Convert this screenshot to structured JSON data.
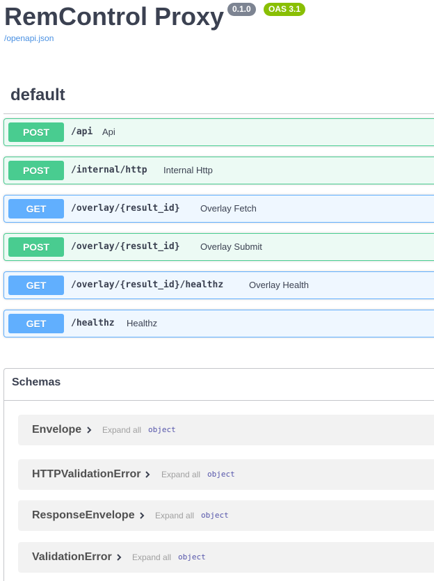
{
  "header": {
    "title": "RemControl Proxy",
    "version": "0.1.0",
    "oas": "OAS 3.1",
    "spec_link": "/openapi.json"
  },
  "section": {
    "title": "default"
  },
  "operations": [
    {
      "method": "POST",
      "path": "/api",
      "summary": "Api"
    },
    {
      "method": "POST",
      "path": "/internal/http",
      "summary": "Internal Http"
    },
    {
      "method": "GET",
      "path": "/overlay/{result_id}",
      "summary": "Overlay Fetch"
    },
    {
      "method": "POST",
      "path": "/overlay/{result_id}",
      "summary": "Overlay Submit"
    },
    {
      "method": "GET",
      "path": "/overlay/{result_id}/healthz",
      "summary": "Overlay Health"
    },
    {
      "method": "GET",
      "path": "/healthz",
      "summary": "Healthz"
    }
  ],
  "schemas": {
    "title": "Schemas",
    "items": [
      {
        "name": "Envelope",
        "expand": "Expand all",
        "type": "object"
      },
      {
        "name": "HTTPValidationError",
        "expand": "Expand all",
        "type": "object"
      },
      {
        "name": "ResponseEnvelope",
        "expand": "Expand all",
        "type": "object"
      },
      {
        "name": "ValidationError",
        "expand": "Expand all",
        "type": "object"
      }
    ]
  },
  "colors": {
    "post": "#49cc90",
    "get": "#61affe",
    "version_badge": "#7d8492",
    "oas_badge": "#89bf04",
    "link": "#4990e2"
  }
}
